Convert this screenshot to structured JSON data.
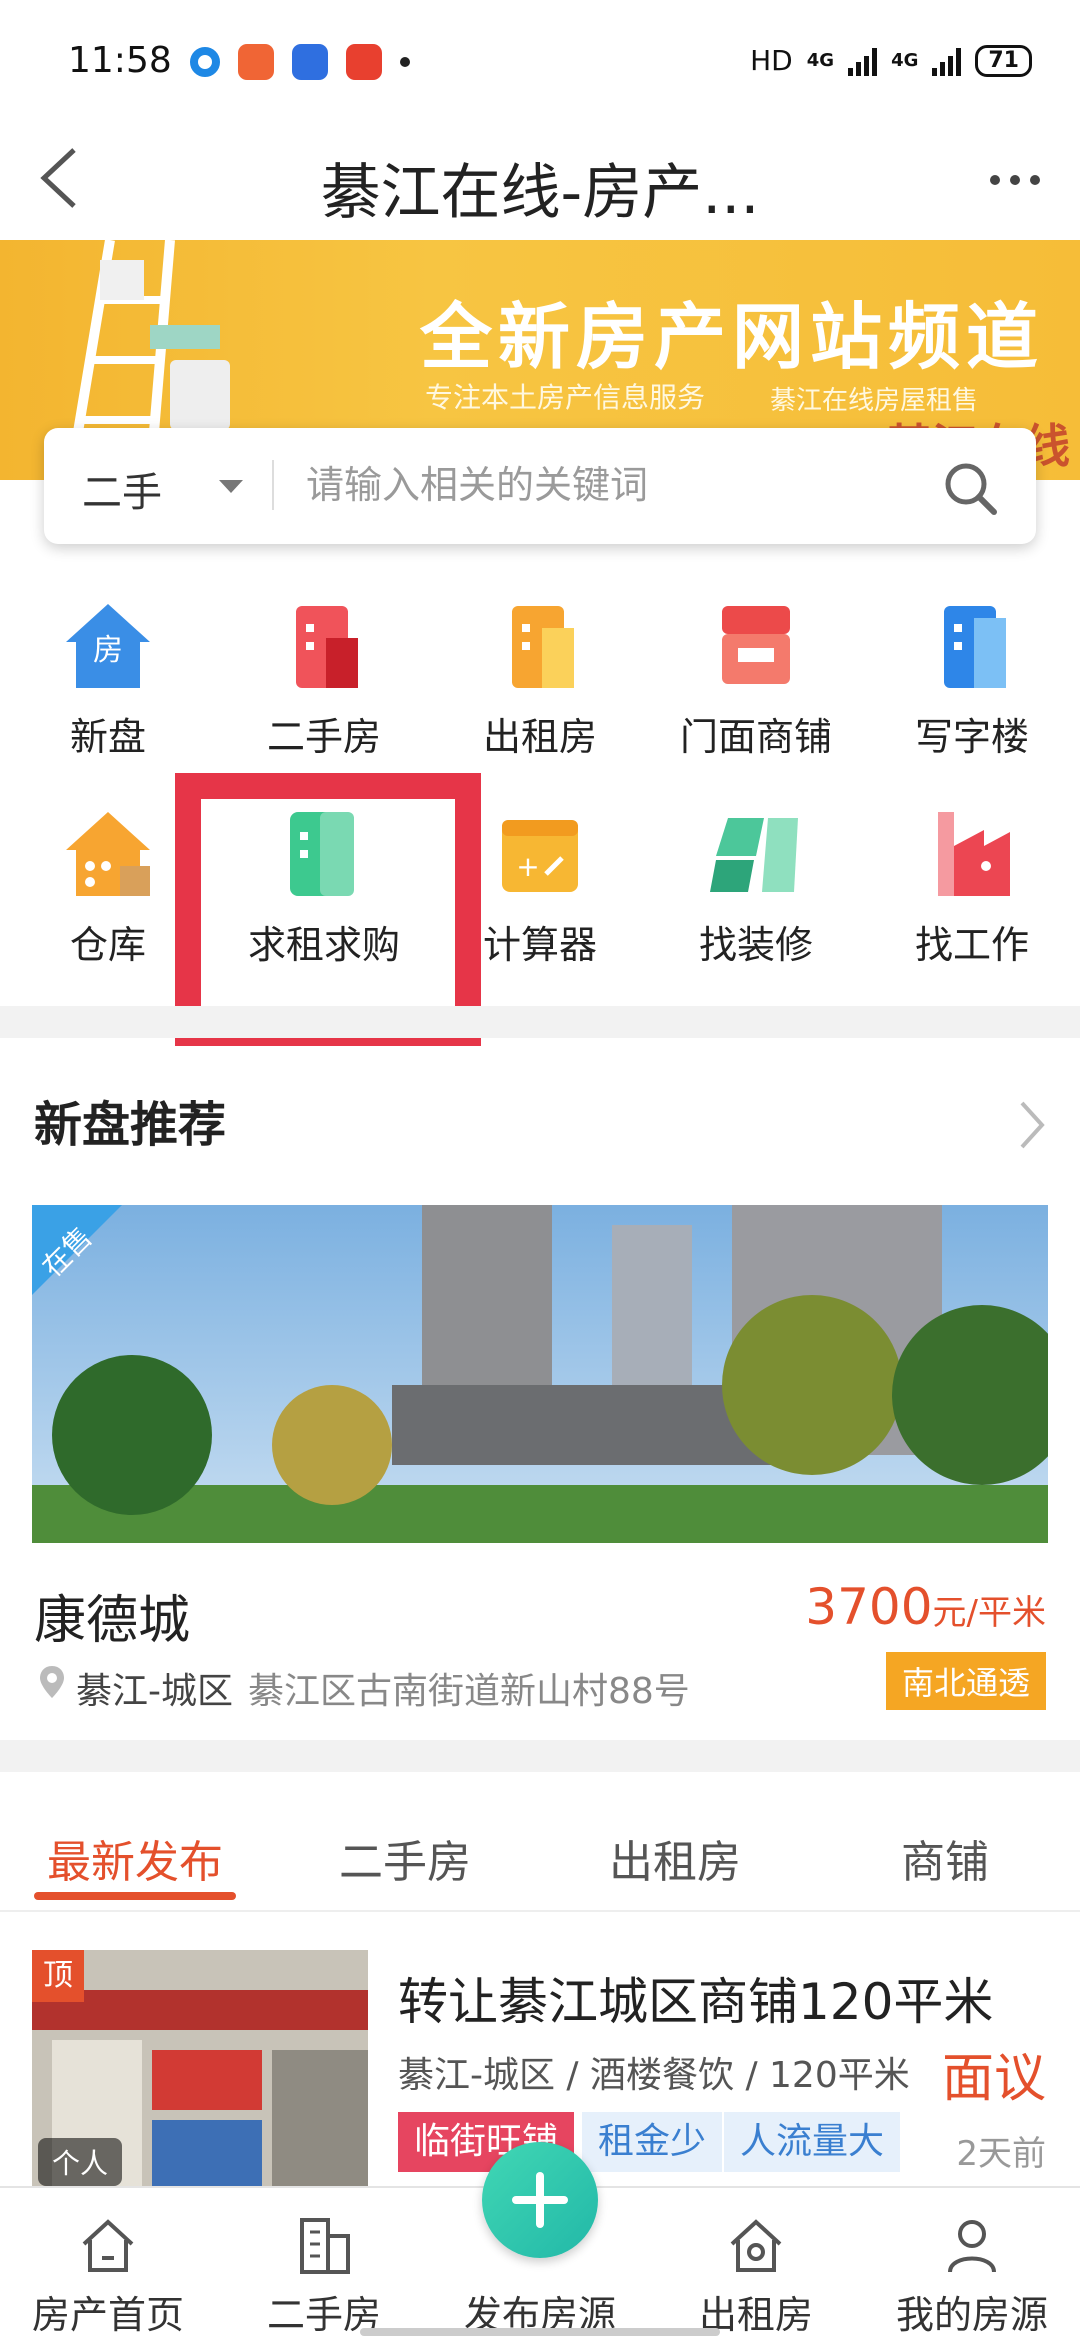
{
  "status_bar": {
    "time": "11:58",
    "hd": "HD",
    "net1": "4G",
    "net2": "4G",
    "battery": "71"
  },
  "header": {
    "title": "綦江在线-房产..."
  },
  "banner": {
    "headline": "全新房产网站频道",
    "subline_left": "专注本土房产信息服务",
    "subline_right": "綦江在线房屋租售",
    "logo_text": "綦江在线"
  },
  "search": {
    "type_label": "二手",
    "placeholder": "请输入相关的关键词"
  },
  "categories": [
    {
      "label": "新盘",
      "icon": "new-house-icon"
    },
    {
      "label": "二手房",
      "icon": "second-hand-house-icon"
    },
    {
      "label": "出租房",
      "icon": "rental-house-icon"
    },
    {
      "label": "门面商铺",
      "icon": "shop-icon"
    },
    {
      "label": "写字楼",
      "icon": "office-building-icon"
    },
    {
      "label": "仓库",
      "icon": "warehouse-icon"
    },
    {
      "label": "求租求购",
      "icon": "wanted-icon"
    },
    {
      "label": "计算器",
      "icon": "calculator-icon"
    },
    {
      "label": "找装修",
      "icon": "decoration-icon"
    },
    {
      "label": "找工作",
      "icon": "job-icon"
    }
  ],
  "recommend": {
    "title": "新盘推荐",
    "badge": "在售",
    "name": "康德城",
    "price_number": "3700",
    "price_unit": "元/平米",
    "area": "綦江-城区",
    "address": "綦江区古南街道新山村88号",
    "tag": "南北通透"
  },
  "tabs": [
    {
      "label": "最新发布",
      "active": true
    },
    {
      "label": "二手房",
      "active": false
    },
    {
      "label": "出租房",
      "active": false
    },
    {
      "label": "商铺",
      "active": false
    }
  ],
  "listing": {
    "top_badge": "顶",
    "owner_badge": "个人",
    "title": "转让綦江城区商铺120平米",
    "meta": "綦江-城区 / 酒楼餐饮 / 120平米",
    "price": "面议",
    "tags": [
      "临街旺铺",
      "租金少",
      "人流量大"
    ],
    "time": "2天前"
  },
  "bottom_nav": [
    {
      "label": "房产首页",
      "icon": "home-icon"
    },
    {
      "label": "二手房",
      "icon": "building-icon"
    },
    {
      "label": "发布房源",
      "icon": "plus-icon"
    },
    {
      "label": "出租房",
      "icon": "rent-house-icon"
    },
    {
      "label": "我的房源",
      "icon": "user-icon"
    }
  ],
  "colors": {
    "accent": "#e4502c",
    "highlight_box": "#e63548",
    "fab": "#2cc2ad",
    "banner": "#f5b935"
  }
}
